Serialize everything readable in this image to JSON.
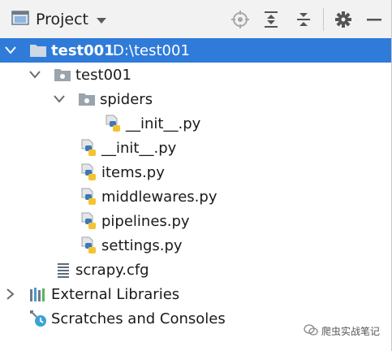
{
  "toolbar": {
    "title": "Project",
    "icons": [
      "project-view-icon",
      "chevron-down-icon",
      "locate-icon",
      "expand-all-icon",
      "collapse-all-icon",
      "gear-icon",
      "minimize-icon"
    ]
  },
  "tree": {
    "root": {
      "name": "test001",
      "path": "D:\\test001"
    },
    "package": "test001",
    "spiders_folder": "spiders",
    "spiders_init": "__init__.py",
    "files": [
      "__init__.py",
      "items.py",
      "middlewares.py",
      "pipelines.py",
      "settings.py"
    ],
    "config": "scrapy.cfg",
    "external_libraries": "External Libraries",
    "scratches": "Scratches and Consoles"
  },
  "watermark": "爬虫实战笔记",
  "colors": {
    "selection": "#2f7bd9",
    "folder": "#9aa4ad",
    "python_blue": "#3b79b8",
    "python_yellow": "#f4c430"
  }
}
